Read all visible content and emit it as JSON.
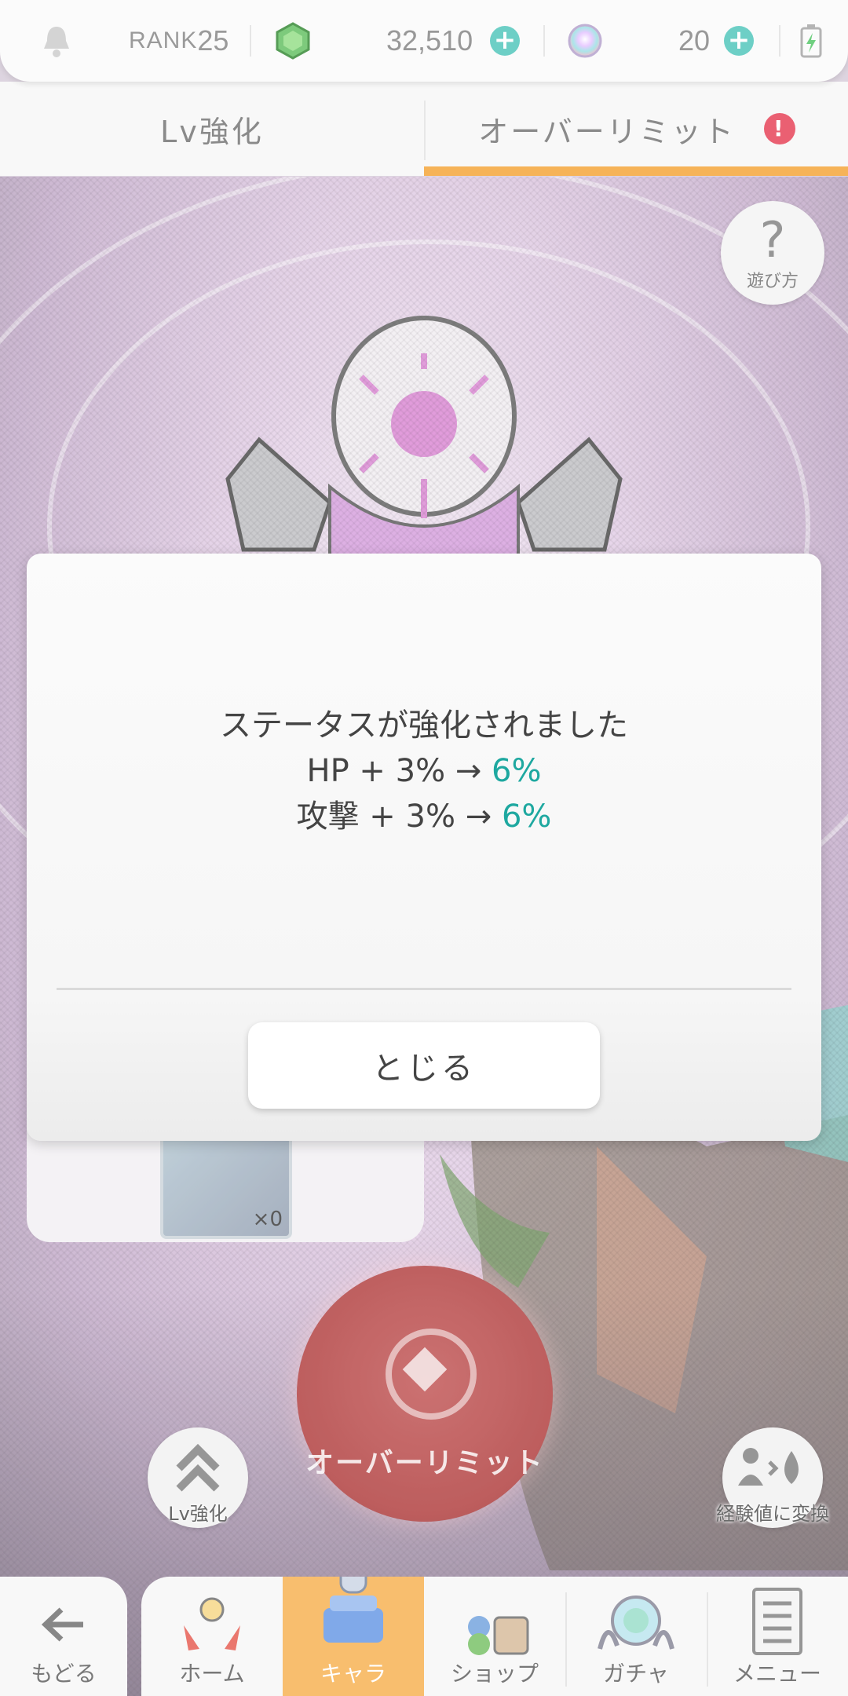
{
  "status_bar": {
    "rank_label": "RANK",
    "rank_value": "25",
    "gem_count": "32,510",
    "orb_count": "20"
  },
  "tabs": [
    {
      "label": "Lv強化"
    },
    {
      "label": "オーバーリミット",
      "active": true,
      "alert": "!"
    }
  ],
  "help": {
    "label": "遊び方",
    "icon": "?"
  },
  "item": {
    "count": "×0"
  },
  "overlimit_button": {
    "label": "オーバーリミット"
  },
  "lv_up_button": {
    "label": "Lv強化"
  },
  "convert_button": {
    "label": "経験値に変換"
  },
  "nav": {
    "back": "もどる",
    "items": [
      {
        "label": "ホーム"
      },
      {
        "label": "キャラ",
        "active": true
      },
      {
        "label": "ショップ"
      },
      {
        "label": "ガチャ"
      },
      {
        "label": "メニュー"
      }
    ]
  },
  "dialog": {
    "title": "ステータスが強化されました",
    "lines": [
      {
        "stat": "HP",
        "delta": "+ 3%",
        "arrow": "→",
        "result": "6%"
      },
      {
        "stat": "攻撃",
        "delta": "+ 3%",
        "arrow": "→",
        "result": "6%"
      }
    ],
    "close_label": "とじる"
  },
  "colors": {
    "accent_orange": "#f5a941",
    "teal": "#1ea8a0",
    "alert_red": "#e84a5f",
    "overlimit_red": "#b44747"
  }
}
